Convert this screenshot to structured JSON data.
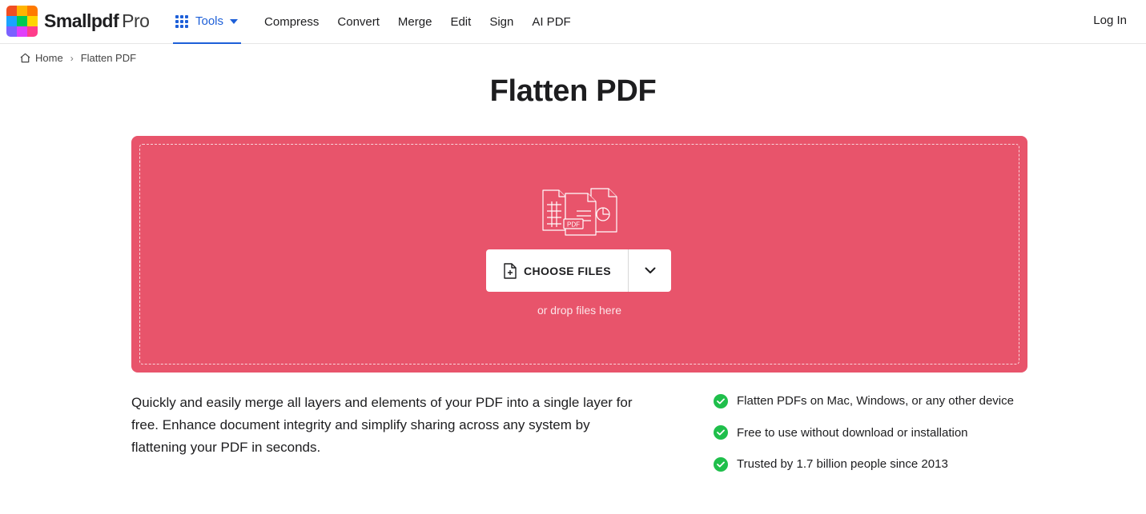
{
  "brand": {
    "name": "Smallpdf",
    "tier": "Pro",
    "logo_colors": [
      "#f04e23",
      "#ffb400",
      "#f04e23",
      "#1aa3ff",
      "#00c853",
      "#ffd400",
      "#7b61ff",
      "#e040fb",
      "#ff3d8b"
    ]
  },
  "nav": {
    "tools_label": "Tools",
    "links": [
      "Compress",
      "Convert",
      "Merge",
      "Edit",
      "Sign",
      "AI PDF"
    ],
    "login_label": "Log In"
  },
  "breadcrumb": {
    "home": "Home",
    "current": "Flatten PDF"
  },
  "page_title": "Flatten PDF",
  "dropzone": {
    "badge": "PDF",
    "choose_label": "CHOOSE FILES",
    "drop_hint": "or drop files here",
    "background_color": "#e8546b"
  },
  "description": "Quickly and easily merge all layers and elements of your PDF into a single layer for free. Enhance document integrity and simplify sharing across any system by flattening your PDF in seconds.",
  "features": [
    "Flatten PDFs on Mac, Windows, or any other device",
    "Free to use without download or installation",
    "Trusted by 1.7 billion people since 2013"
  ],
  "accent_color": "#1d5fd8",
  "check_color": "#1fbf4b"
}
